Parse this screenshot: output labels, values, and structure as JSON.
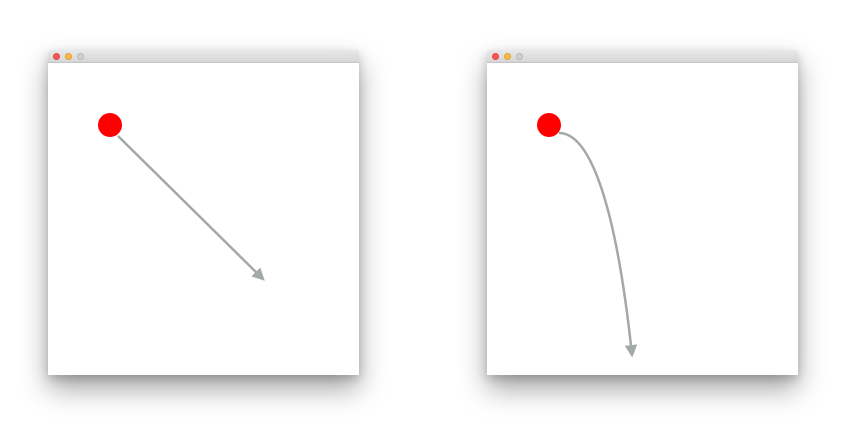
{
  "colors": {
    "circle": "#ff0000",
    "arrow": "#a3a8a8",
    "window_bg": "#ffffff"
  },
  "windows": [
    {
      "name": "straight-arrow-window",
      "arrow_style": "straight"
    },
    {
      "name": "curved-arrow-window",
      "arrow_style": "curved"
    }
  ]
}
